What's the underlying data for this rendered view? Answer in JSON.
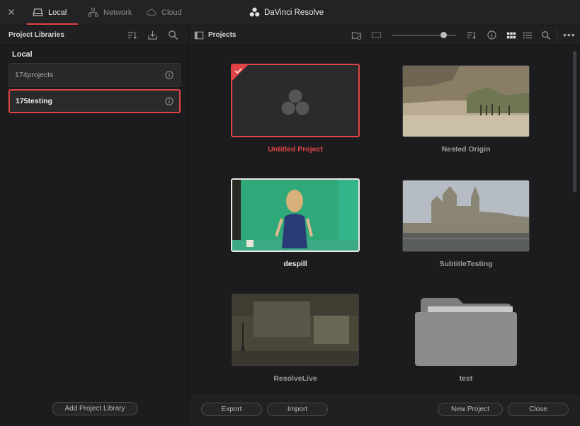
{
  "topbar": {
    "tabs": [
      {
        "label": "Local",
        "icon": "hard-drive-icon"
      },
      {
        "label": "Network",
        "icon": "network-icon"
      },
      {
        "label": "Cloud",
        "icon": "cloud-icon"
      }
    ],
    "app_title": "DaVinci Resolve"
  },
  "left": {
    "header": "Project Libraries",
    "group_label": "Local",
    "libraries": [
      {
        "name": "174projects",
        "selected": false
      },
      {
        "name": "175testing",
        "selected": true
      }
    ],
    "add_button": "Add Project Library"
  },
  "right": {
    "header": "Projects",
    "projects": [
      {
        "name": "Untitled Project",
        "state": "selected"
      },
      {
        "name": "Nested Origin",
        "state": "normal"
      },
      {
        "name": "despill",
        "state": "highlighted"
      },
      {
        "name": "SubtitleTesting",
        "state": "normal"
      },
      {
        "name": "ResolveLive",
        "state": "normal"
      },
      {
        "name": "test",
        "state": "folder"
      }
    ],
    "buttons": {
      "export": "Export",
      "import": "Import",
      "new_project": "New Project",
      "close": "Close"
    }
  },
  "colors": {
    "accent": "#e04444",
    "background": "#1c1c1e"
  }
}
